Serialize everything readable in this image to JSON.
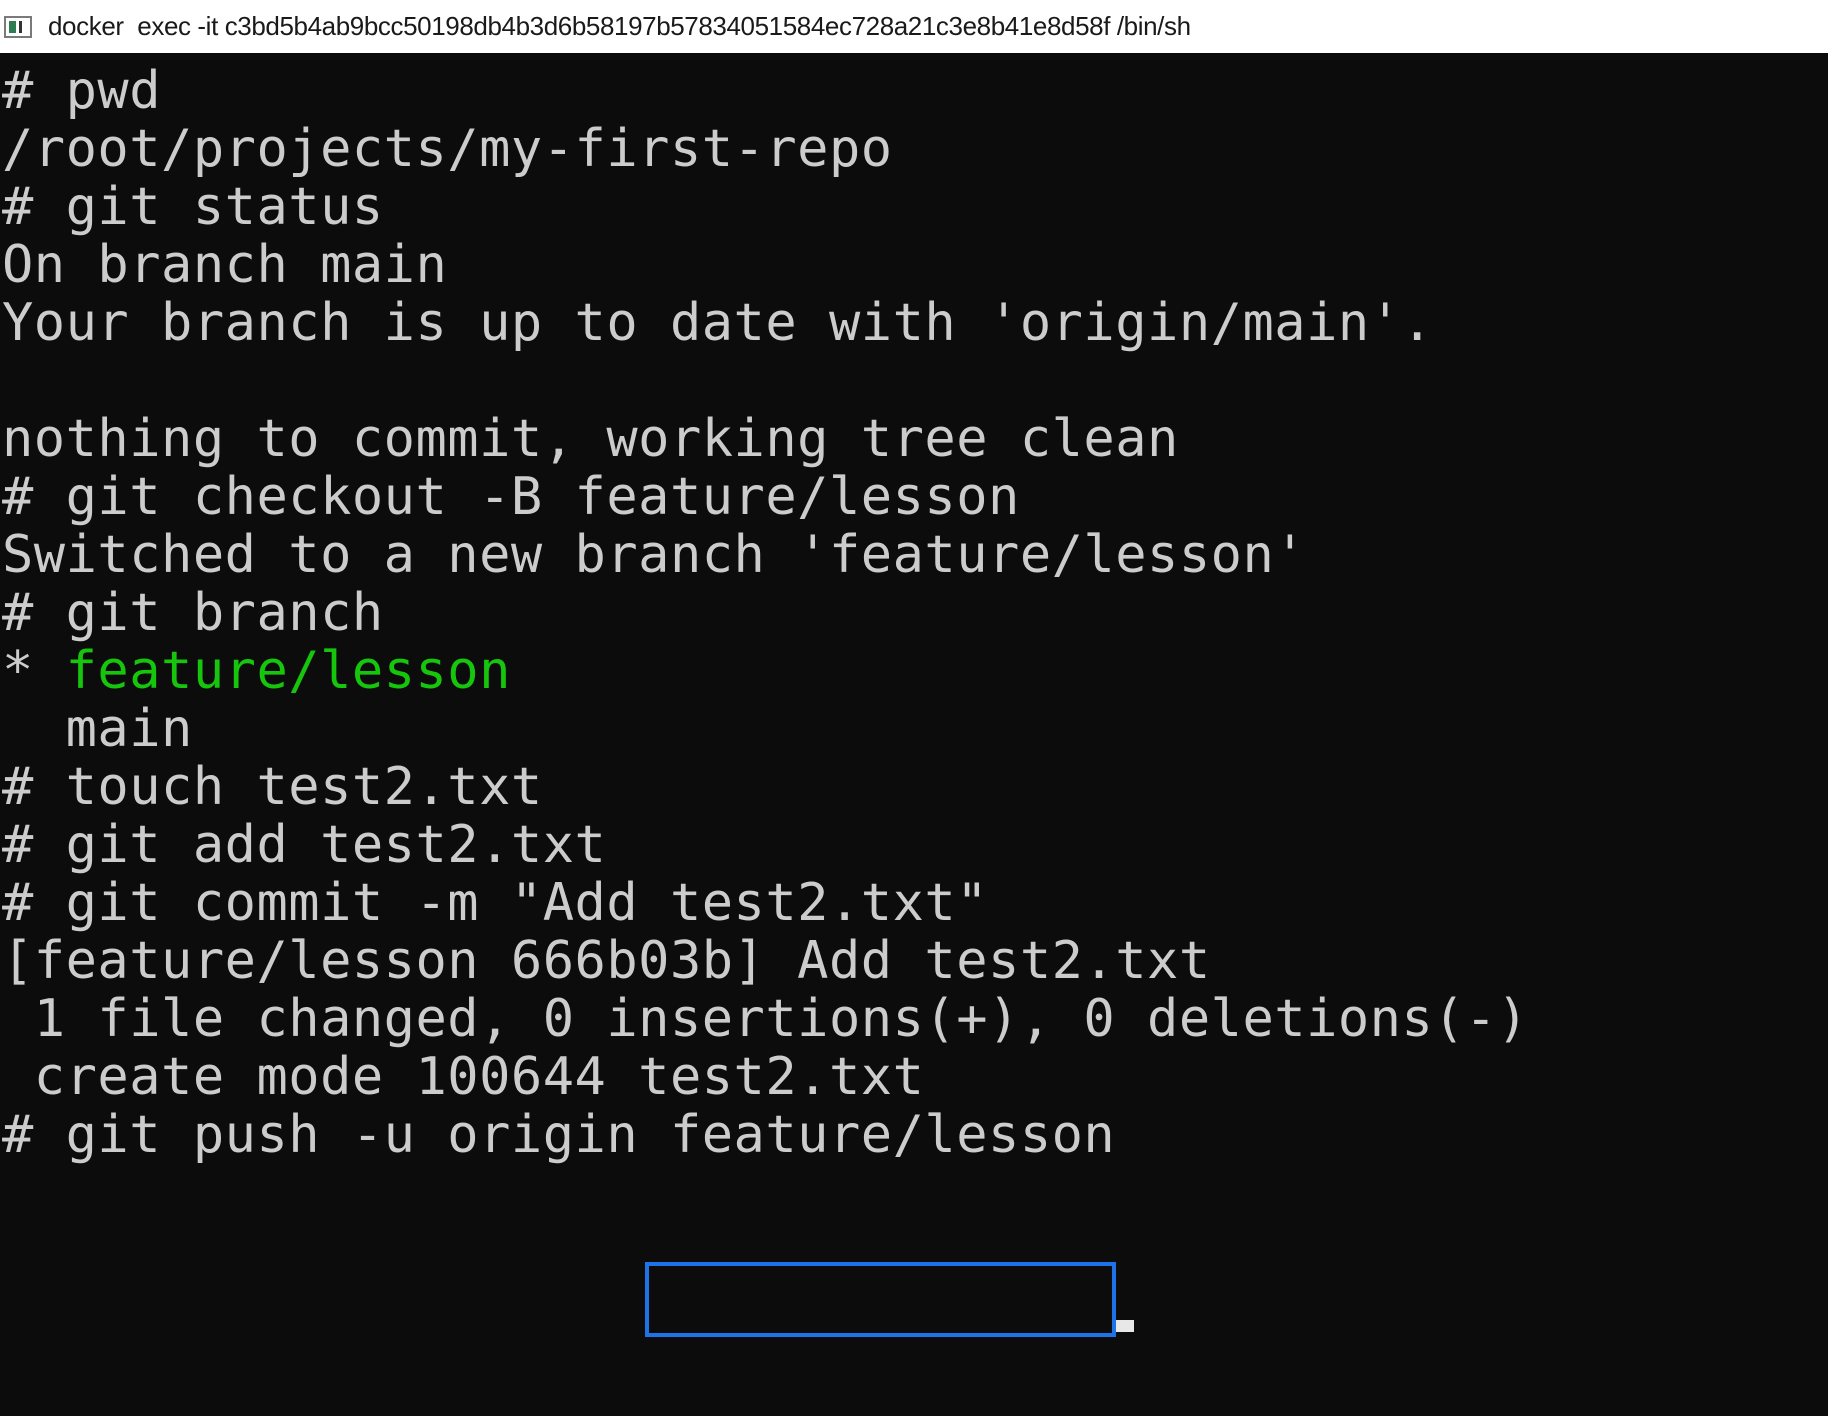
{
  "window": {
    "title": "docker  exec -it c3bd5b4ab9bcc50198db4b3d6b58197b57834051584ec728a21c3e8b41e8d58f /bin/sh",
    "icon": "terminal-icon"
  },
  "terminal": {
    "lines": [
      {
        "text": "# pwd"
      },
      {
        "text": "/root/projects/my-first-repo"
      },
      {
        "text": "# git status"
      },
      {
        "text": "On branch main"
      },
      {
        "text": "Your branch is up to date with 'origin/main'."
      },
      {
        "text": ""
      },
      {
        "text": "nothing to commit, working tree clean"
      },
      {
        "text": "# git checkout -B feature/lesson"
      },
      {
        "text": "Switched to a new branch 'feature/lesson'"
      },
      {
        "text": "# git branch"
      },
      {
        "prefix": "* ",
        "branch": "feature/lesson"
      },
      {
        "text": "  main"
      },
      {
        "text": "# touch test2.txt"
      },
      {
        "text": "# git add test2.txt"
      },
      {
        "text": "# git commit -m \"Add test2.txt\""
      },
      {
        "text": "[feature/lesson 666b03b] Add test2.txt"
      },
      {
        "text": " 1 file changed, 0 insertions(+), 0 deletions(-)"
      },
      {
        "text": " create mode 100644 test2.txt"
      },
      {
        "text": "# git push -u origin feature/lesson"
      }
    ]
  },
  "colors": {
    "background": "#0c0c0c",
    "foreground": "#cccccc",
    "current_branch": "#16c60c",
    "highlight_box": "#1e73e8"
  }
}
